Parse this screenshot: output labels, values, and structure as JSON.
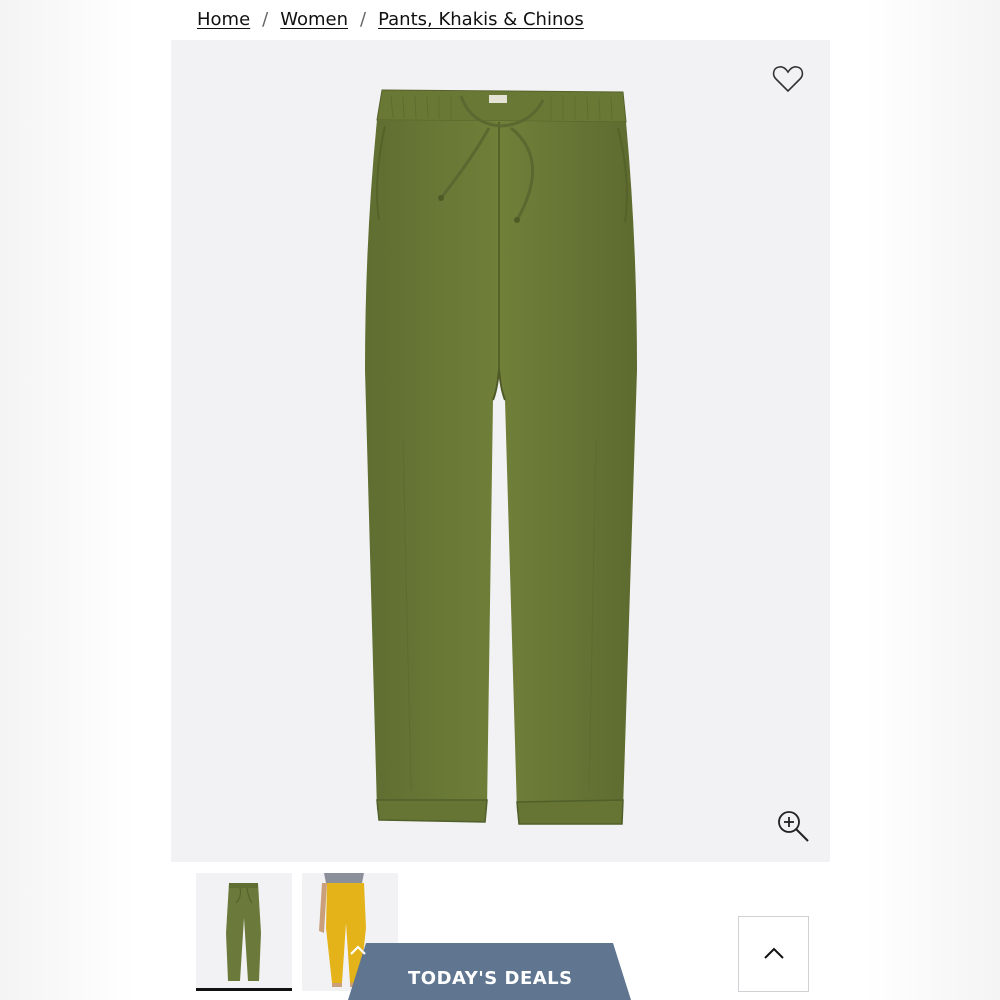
{
  "breadcrumb": {
    "items": [
      "Home",
      "Women",
      "Pants, Khakis & Chinos"
    ],
    "separator": "/"
  },
  "product": {
    "color_hex": "#6b7a3a",
    "thumbnails": [
      {
        "name": "olive-pants-flat",
        "active": true
      },
      {
        "name": "yellow-pants-model",
        "active": false
      }
    ]
  },
  "icons": {
    "favorite": "heart-icon",
    "zoom": "zoom-in-icon",
    "deals_toggle": "chevron-up-icon",
    "back_to_top": "chevron-up-icon"
  },
  "deals": {
    "label": "TODAY'S DEALS",
    "color": "#5f7590"
  }
}
